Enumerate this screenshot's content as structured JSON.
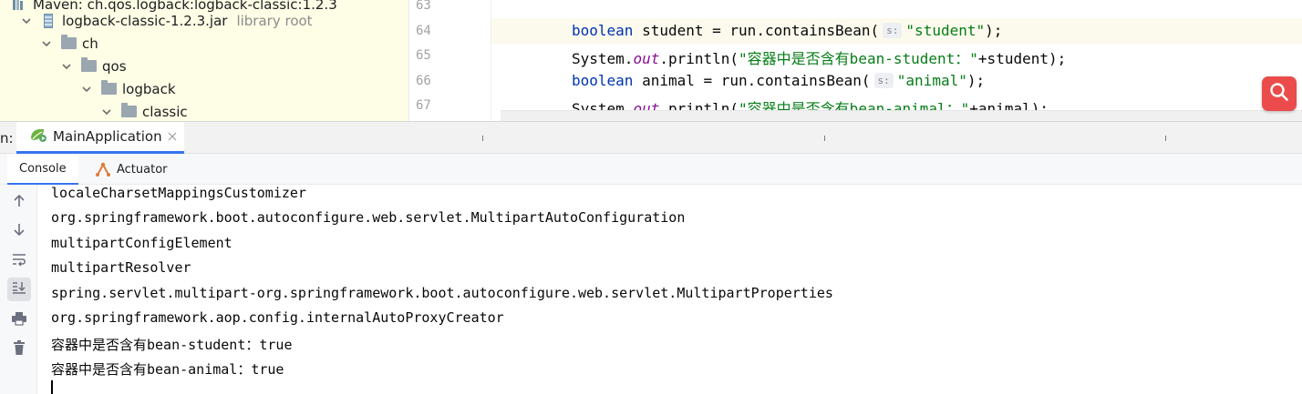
{
  "project_tree": {
    "rows": [
      {
        "label": "Maven: ch.qos.logback:logback-classic:1.2.3",
        "muted": ""
      },
      {
        "label": "logback-classic-1.2.3.jar",
        "muted": "library root"
      },
      {
        "label": "ch",
        "muted": ""
      },
      {
        "label": "qos",
        "muted": ""
      },
      {
        "label": "logback",
        "muted": ""
      },
      {
        "label": "classic",
        "muted": ""
      }
    ]
  },
  "editor": {
    "line_numbers": [
      "63",
      "64",
      "65",
      "66",
      "67"
    ],
    "lines": {
      "l64": {
        "kw": "boolean",
        "rest1": " student = ",
        "var": "run",
        "call": ".containsBean(",
        "hint": "s:",
        "str": "\"student\"",
        "end": ");"
      },
      "l65": {
        "pre": "System.",
        "field": "out",
        "call": ".println(",
        "str": "\"容器中是否含有bean-student：\"",
        "end": "+student);"
      },
      "l66": {
        "kw": "boolean",
        "rest1": " animal = ",
        "var": "run",
        "call": ".containsBean(",
        "hint": "s:",
        "str": "\"animal\"",
        "end": ");"
      },
      "l67": {
        "pre": "System.",
        "field": "out",
        "call": ".println(",
        "str": "\"容器中是否含有bean-animal：\"",
        "end": "+animal);"
      }
    }
  },
  "run_window": {
    "prefix": "n:",
    "tab_label": "MainApplication",
    "sub_tabs": [
      "Console",
      "Actuator"
    ]
  },
  "console": {
    "lines": [
      "localeCharsetMappingsCustomizer",
      "org.springframework.boot.autoconfigure.web.servlet.MultipartAutoConfiguration",
      "multipartConfigElement",
      "multipartResolver",
      "spring.servlet.multipart-org.springframework.boot.autoconfigure.web.servlet.MultipartProperties",
      "org.springframework.aop.config.internalAutoProxyCreator",
      "容器中是否含有bean-student：true",
      "容器中是否含有bean-animal：true"
    ]
  },
  "icons": {
    "toolbar": [
      "arrow-up-icon",
      "arrow-down-icon",
      "soft-wrap-icon",
      "scroll-to-end-icon",
      "print-icon",
      "trash-icon"
    ],
    "floating": "search-icon"
  },
  "colors": {
    "accent": "#3574f0",
    "tree_bg": "#fefde6",
    "keyword": "#0033b3",
    "string": "#067d17",
    "static_field": "#871094",
    "floating_button": "#eb4c4b"
  }
}
